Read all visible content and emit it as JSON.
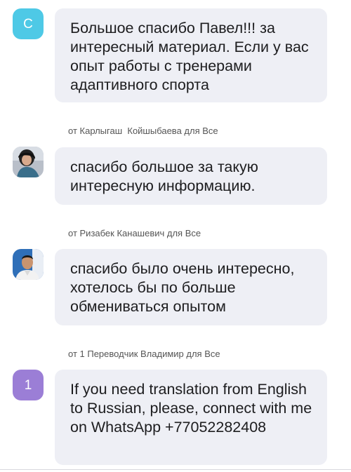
{
  "colors": {
    "bubble_bg": "#eeeff5",
    "avatar_c": "#4ec9e6",
    "avatar_1": "#9b7ed6"
  },
  "messages": [
    {
      "avatar_letter": "С",
      "avatar_icon": "letter-avatar",
      "text": "Большое спасибо Павел!!! за интересный материал. Если у вас опыт работы с тренерами адаптивного спорта"
    },
    {
      "sender_line": "от Карлыгаш  Койшыбаева для Все",
      "avatar_icon": "user-photo-avatar",
      "text": "спасибо большое за такую интересную информацию."
    },
    {
      "sender_line": "от Ризабек Канашевич для Все",
      "avatar_icon": "user-photo-avatar",
      "text": "спасибо было очень интересно, хотелось бы по больше обмениваться опытом"
    },
    {
      "sender_line": "от 1 Переводчик Владимир для Все",
      "avatar_letter": "1",
      "avatar_icon": "letter-avatar",
      "text": "If you need translation from English to Russian, please, connect with me on WhatsApp +77052282408"
    }
  ]
}
